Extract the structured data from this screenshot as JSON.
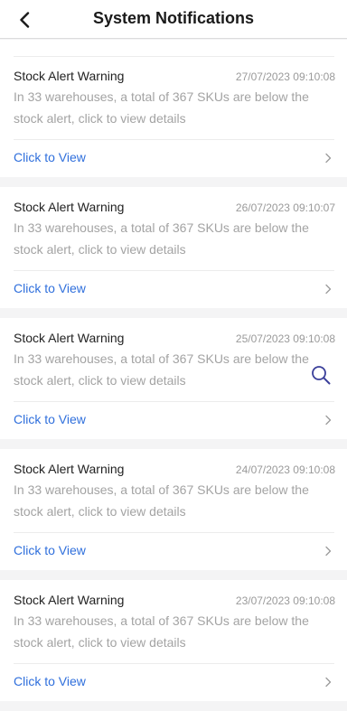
{
  "header": {
    "title": "System Notifications",
    "back_icon": "chevron-left-icon"
  },
  "notifications": [
    {
      "title": "Stock Alert Warning",
      "time": "27/07/2023 09:10:08",
      "desc": "In 33 warehouses, a total of 367 SKUs are below the stock alert, click to view details",
      "link": "Click to View"
    },
    {
      "title": "Stock Alert Warning",
      "time": "26/07/2023 09:10:07",
      "desc": "In 33 warehouses, a total of 367 SKUs are below the stock alert, click to view details",
      "link": "Click to View"
    },
    {
      "title": "Stock Alert Warning",
      "time": "25/07/2023 09:10:08",
      "desc": "In 33 warehouses, a total of 367 SKUs are below the stock alert, click to view details",
      "link": "Click to View"
    },
    {
      "title": "Stock Alert Warning",
      "time": "24/07/2023 09:10:08",
      "desc": "In 33 warehouses, a total of 367 SKUs are below the stock alert, click to view details",
      "link": "Click to View"
    },
    {
      "title": "Stock Alert Warning",
      "time": "23/07/2023 09:10:08",
      "desc": "In 33 warehouses, a total of 367 SKUs are below the stock alert, click to view details",
      "link": "Click to View"
    }
  ],
  "floating_icon": "search-icon",
  "colors": {
    "link": "#2f6fdc",
    "background": "#f4f4f5",
    "muted_text": "#a3a3a3"
  }
}
